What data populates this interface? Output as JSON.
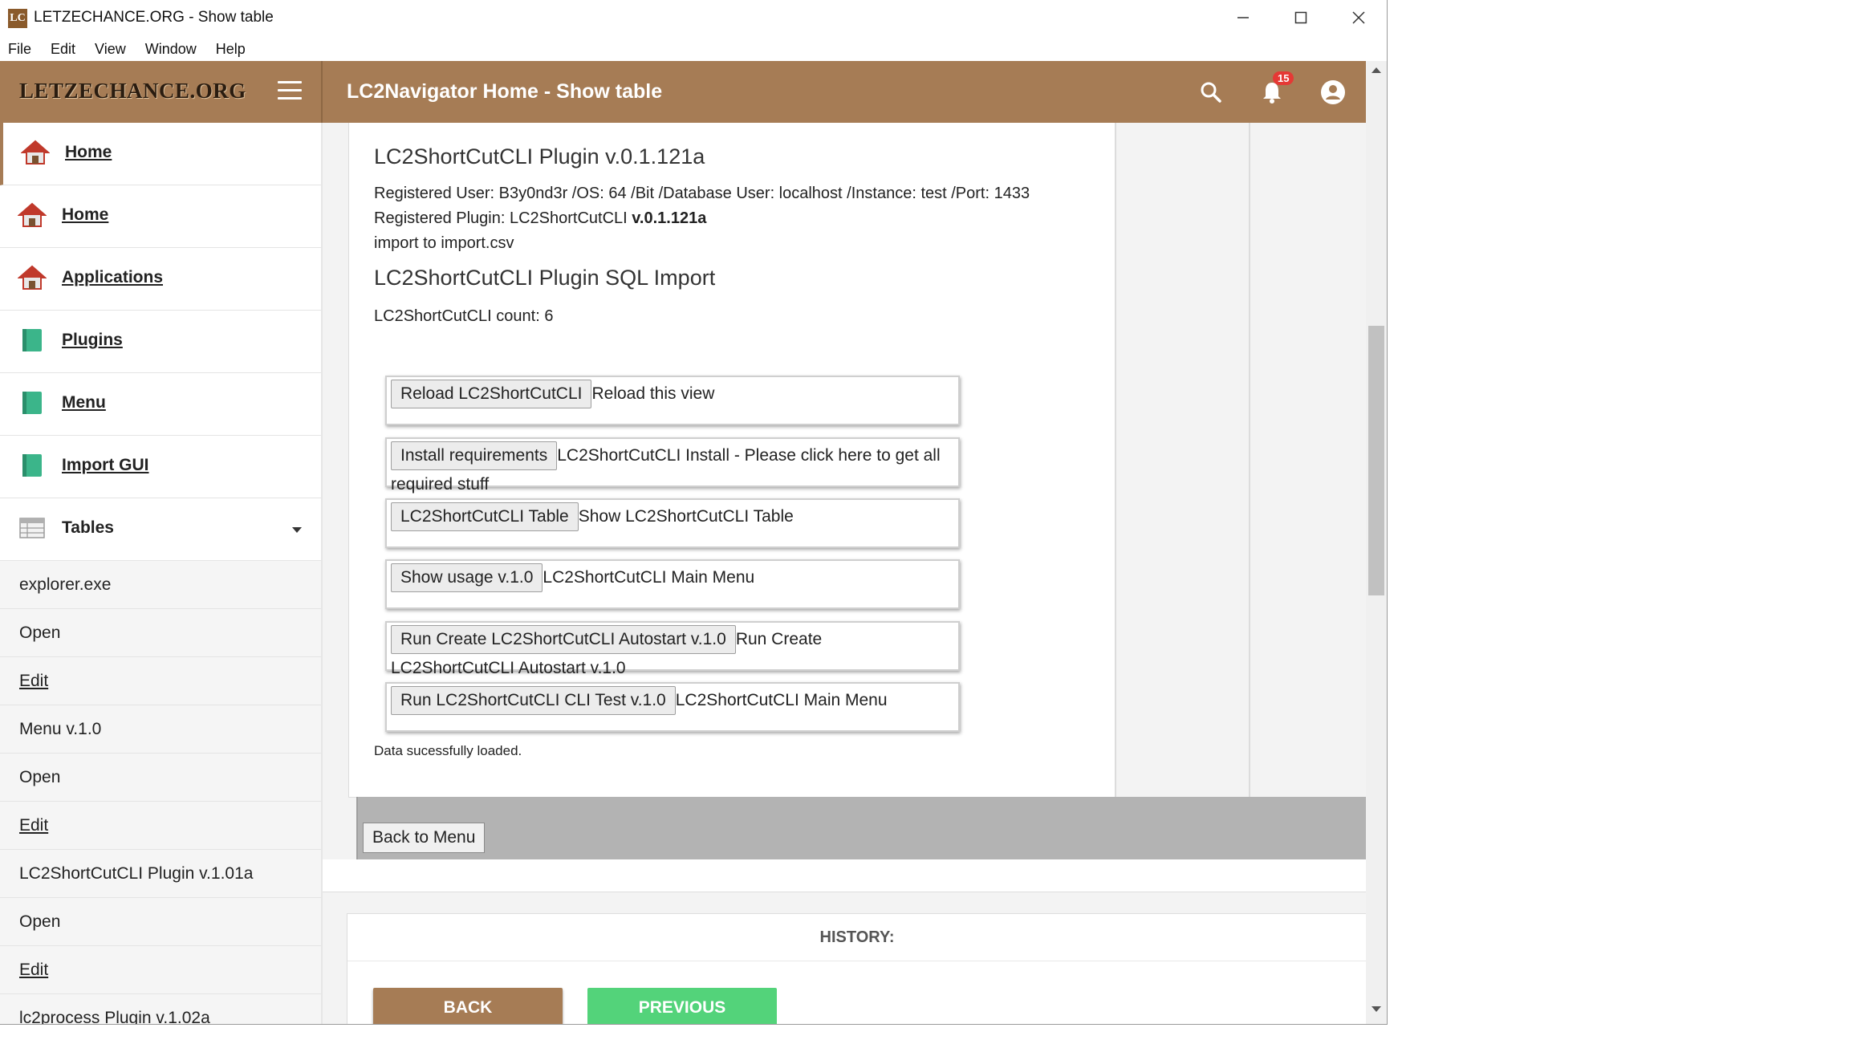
{
  "window": {
    "title": "LETZECHANCE.ORG - Show table",
    "logo_text": "LC"
  },
  "menubar": [
    "File",
    "Edit",
    "View",
    "Window",
    "Help"
  ],
  "header": {
    "brand": "LETZECHANCE.ORG",
    "title": "LC2Navigator Home - Show table",
    "notification_count": "15",
    "color": "#a67c55"
  },
  "sidebar": {
    "items": [
      {
        "label": "Home",
        "icon": "house-icon"
      },
      {
        "label": "Home",
        "icon": "house-icon"
      },
      {
        "label": "Applications",
        "icon": "house-icon"
      },
      {
        "label": "Plugins",
        "icon": "book-icon"
      },
      {
        "label": "Menu",
        "icon": "book-icon"
      },
      {
        "label": "Import GUI",
        "icon": "book-icon"
      }
    ],
    "tables_label": "Tables",
    "sub_items": [
      "explorer.exe",
      "Open",
      "Edit",
      "Menu v.1.0",
      "Open",
      "Edit",
      "LC2ShortCutCLI Plugin v.1.01a",
      "Open",
      "Edit",
      "lc2process Plugin v.1.02a"
    ]
  },
  "content": {
    "plugin_title": "LC2ShortCutCLI Plugin v.0.1.121a",
    "registered_user": "Registered User: B3y0nd3r /OS: 64 /Bit /Database User: localhost /Instance: test /Port: 1433",
    "registered_plugin_prefix": "Registered Plugin: LC2ShortCutCLI ",
    "registered_plugin_version": "v.0.1.121a",
    "import_line": "import to import.csv",
    "import_title": "LC2ShortCutCLI Plugin SQL Import",
    "count": "LC2ShortCutCLI count: 6",
    "actions": [
      {
        "button": "Reload LC2ShortCutCLI",
        "description": "Reload this view"
      },
      {
        "button": "Install requirements",
        "description": "LC2ShortCutCLI Install - Please click here to get all required stuff"
      },
      {
        "button": "LC2ShortCutCLI Table",
        "description": "Show LC2ShortCutCLI Table"
      },
      {
        "button": "Show usage v.1.0",
        "description": "LC2ShortCutCLI Main Menu"
      },
      {
        "button": "Run Create LC2ShortCutCLI Autostart v.1.0",
        "description": "Run Create LC2ShortCutCLI Autostart v.1.0"
      },
      {
        "button": "Run LC2ShortCutCLI CLI Test v.1.0",
        "description": "LC2ShortCutCLI Main Menu"
      }
    ],
    "status": "Data sucessfully loaded.",
    "back_to_menu": "Back to Menu",
    "history_title": "HISTORY:",
    "back_button": "BACK",
    "previous_button": "PREVIOUS"
  }
}
